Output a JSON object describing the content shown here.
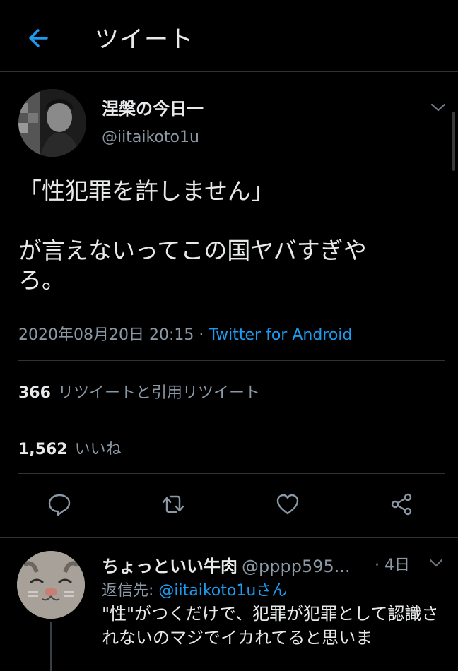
{
  "header": {
    "title": "ツイート",
    "back_icon": "arrow-left-icon",
    "accent": "#1d9bf0"
  },
  "tweet": {
    "author_name": "涅槃の今日一",
    "author_handle": "@iitaikoto1u",
    "text": "「性犯罪を許しません」\n\nが言えないってこの国ヤバすぎや\nろ。",
    "date": "2020年08月20日 20:15",
    "separator": " · ",
    "source": "Twitter for Android",
    "retweets_count": "366",
    "retweets_label": "リツイートと引用リツイート",
    "likes_count": "1,562",
    "likes_label": "いいね"
  },
  "actions": [
    "reply-icon",
    "retweet-icon",
    "like-icon",
    "share-icon"
  ],
  "reply": {
    "name": "ちょっといい牛肉",
    "handle": "@pppp595...",
    "age": "· 4日",
    "reply_to_label": "返信先: ",
    "reply_to_mention": "@iitaikoto1uさん",
    "text": "\"性\"がつくだけで、犯罪が犯罪として認識されないのマジでイカれてると思いま"
  },
  "colors": {
    "background": "#000000",
    "text": "#e7e9ea",
    "muted": "#8b98a5",
    "link": "#1d9bf0",
    "divider": "#2f3336"
  }
}
